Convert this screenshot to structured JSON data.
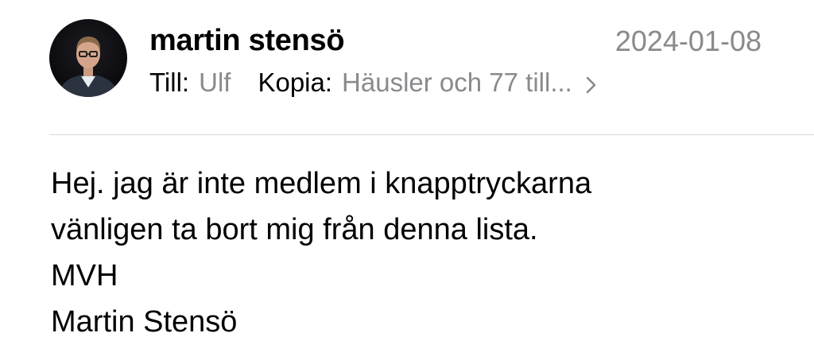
{
  "message": {
    "sender_name": "martin stensö",
    "date": "2024-01-08",
    "to_label": "Till:",
    "to_value": "Ulf",
    "cc_label": "Kopia:",
    "cc_value": "Häusler och 77 till...",
    "expand_icon": "chevron-right-icon",
    "avatar_icon": "avatar-photo",
    "body_lines": [
      "Hej. jag är inte medlem i knapptryckarna",
      "vänligen ta bort mig från denna lista.",
      "MVH",
      "Martin Stensö"
    ]
  },
  "colors": {
    "text_primary": "#000000",
    "text_secondary": "#8a8a8e",
    "divider": "#d8d8dc",
    "background": "#ffffff"
  }
}
